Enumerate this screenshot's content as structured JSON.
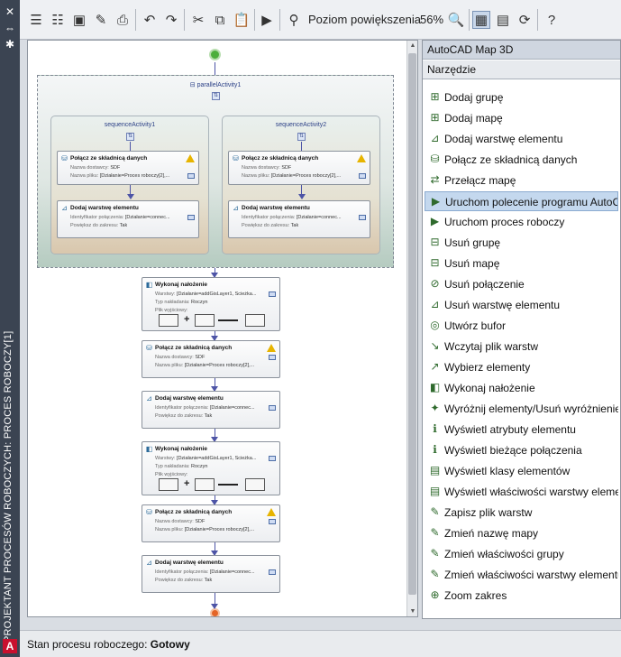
{
  "sidebar": {
    "vertical_title": "PROJEKTANT PROCESÓW ROBOCZYCH: PROCES ROBOCZY[1]",
    "icons": [
      "close-icon",
      "pin-icon",
      "settings-icon"
    ]
  },
  "toolbar": {
    "zoom_label": "Poziom powiększenia",
    "zoom_value": "56%",
    "buttons": [
      "new-workflow",
      "new-sequence",
      "save",
      "save-as",
      "print",
      "undo",
      "redo",
      "cut",
      "copy",
      "paste",
      "run",
      "zoom-mode",
      "zoom",
      "fit",
      "properties",
      "refresh",
      "help"
    ]
  },
  "designer": {
    "parallel_title": "parallelActivity1",
    "sequences": [
      {
        "title": "sequenceActivity1",
        "activities": [
          {
            "title": "Połącz ze składnicą danych",
            "lines": [
              [
                "Nazwa dostawcy:",
                "SDF"
              ],
              [
                "Nazwa pliku:",
                "[Działanie=Proces roboczy[2],..."
              ]
            ],
            "warning": true
          },
          {
            "title": "Dodaj warstwę elementu",
            "lines": [
              [
                "Identyfikator połączenia:",
                "[Działanie=connec..."
              ],
              [
                "Powiększ do zakresu:",
                "Tak"
              ]
            ],
            "warning": false
          }
        ]
      },
      {
        "title": "sequenceActivity2",
        "activities": [
          {
            "title": "Połącz ze składnicą danych",
            "lines": [
              [
                "Nazwa dostawcy:",
                "SDF"
              ],
              [
                "Nazwa pliku:",
                "[Działanie=Proces roboczy[2],..."
              ]
            ],
            "warning": true
          },
          {
            "title": "Dodaj warstwę elementu",
            "lines": [
              [
                "Identyfikator połączenia:",
                "[Działanie=connec..."
              ],
              [
                "Powiększ do zakresu:",
                "Tak"
              ]
            ],
            "warning": false
          }
        ]
      }
    ],
    "main_activities": [
      {
        "title": "Wykonaj nałożenie",
        "lines": [
          [
            "Warstwy:",
            "[Działanie=addGisLayer1, Ścieżka..."
          ],
          [
            "Typ nakładania:",
            "Roczyn"
          ],
          [
            "Plik wyjściowy:",
            ""
          ]
        ],
        "warning": false,
        "diagram": true
      },
      {
        "title": "Połącz ze składnicą danych",
        "lines": [
          [
            "Nazwa dostawcy:",
            "SDF"
          ],
          [
            "Nazwa pliku:",
            "[Działanie=Proces roboczy[2],..."
          ]
        ],
        "warning": true,
        "diagram": false
      },
      {
        "title": "Dodaj warstwę elementu",
        "lines": [
          [
            "Identyfikator połączenia:",
            "[Działanie=connec..."
          ],
          [
            "Powiększ do zakresu:",
            "Tak"
          ]
        ],
        "warning": false,
        "diagram": false
      },
      {
        "title": "Wykonaj nałożenie",
        "lines": [
          [
            "Warstwy:",
            "[Działanie=addGisLayer1, Ścieżka..."
          ],
          [
            "Typ nakładania:",
            "Roczyn"
          ],
          [
            "Plik wyjściowy:",
            ""
          ]
        ],
        "warning": false,
        "diagram": true
      },
      {
        "title": "Połącz ze składnicą danych",
        "lines": [
          [
            "Nazwa dostawcy:",
            "SDF"
          ],
          [
            "Nazwa pliku:",
            "[Działanie=Proces roboczy[2],..."
          ]
        ],
        "warning": true,
        "diagram": false
      },
      {
        "title": "Dodaj warstwę elementu",
        "lines": [
          [
            "Identyfikator połączenia:",
            "[Działanie=connec..."
          ],
          [
            "Powiększ do zakresu:",
            "Tak"
          ]
        ],
        "warning": false,
        "diagram": false
      }
    ]
  },
  "panel": {
    "header": "AutoCAD Map 3D",
    "subheader": "Narzędzie",
    "selected_index": 5,
    "items": [
      "Dodaj grupę",
      "Dodaj mapę",
      "Dodaj warstwę elementu",
      "Połącz ze składnicą danych",
      "Przełącz mapę",
      "Uruchom polecenie programu AutoCAD",
      "Uruchom proces roboczy",
      "Usuń grupę",
      "Usuń mapę",
      "Usuń połączenie",
      "Usuń warstwę elementu",
      "Utwórz bufor",
      "Wczytaj plik warstw",
      "Wybierz elementy",
      "Wykonaj nałożenie",
      "Wyróżnij elementy/Usuń wyróżnienie",
      "Wyświetl atrybuty elementu",
      "Wyświetl bieżące połączenia",
      "Wyświetl klasy elementów",
      "Wyświetl właściwości warstwy elementu",
      "Zapisz plik warstw",
      "Zmień nazwę mapy",
      "Zmień właściwości grupy",
      "Zmień właściwości warstwy elementu",
      "Zoom zakres"
    ]
  },
  "status": {
    "label": "Stan procesu roboczego:",
    "value": "Gotowy"
  }
}
